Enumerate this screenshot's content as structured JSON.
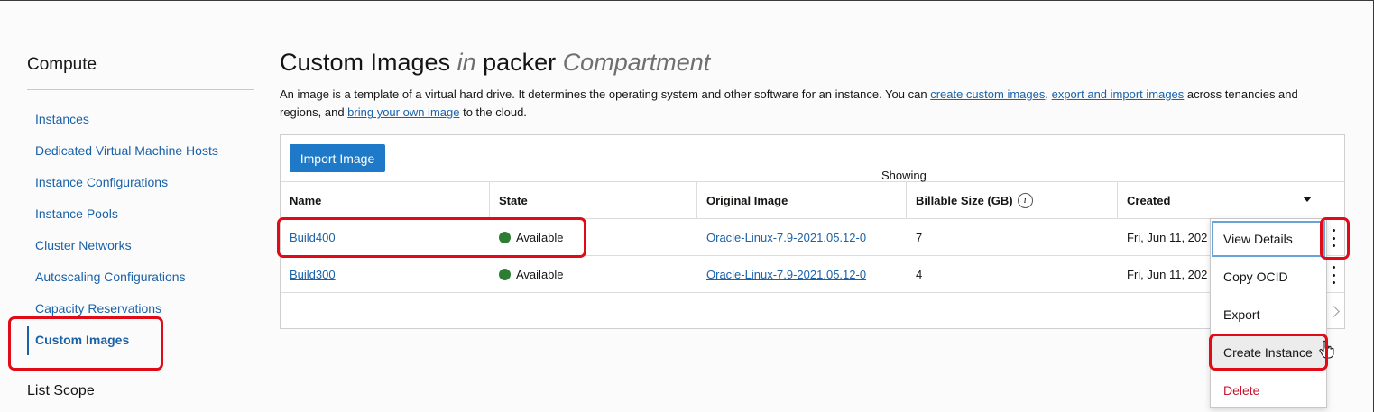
{
  "sidebar": {
    "title": "Compute",
    "items": [
      {
        "label": "Instances"
      },
      {
        "label": "Dedicated Virtual Machine Hosts"
      },
      {
        "label": "Instance Configurations"
      },
      {
        "label": "Instance Pools"
      },
      {
        "label": "Cluster Networks"
      },
      {
        "label": "Autoscaling Configurations"
      },
      {
        "label": "Capacity Reservations"
      },
      {
        "label": "Custom Images",
        "active": true
      }
    ],
    "list_scope_label": "List Scope"
  },
  "header": {
    "title_main": "Custom Images",
    "title_in": "in",
    "compartment": "packer",
    "compartment_suffix": "Compartment"
  },
  "description": {
    "part1": "An image is a template of a virtual hard drive. It determines the operating system and other software for an instance. You can ",
    "link1": "create custom images",
    "part2": ", ",
    "link2": "export and import images",
    "part3": " across tenancies and regions, and ",
    "link3": "bring your own image",
    "part4": " to the cloud."
  },
  "toolbar": {
    "import_label": "Import Image"
  },
  "table": {
    "columns": [
      "Name",
      "State",
      "Original Image",
      "Billable Size (GB)",
      "Created"
    ],
    "info_icon": "i",
    "rows": [
      {
        "name": "Build400",
        "state": "Available",
        "original_image": "Oracle-Linux-7.9-2021.05.12-0",
        "size": "7",
        "created": "Fri, Jun 11, 202"
      },
      {
        "name": "Build300",
        "state": "Available",
        "original_image": "Oracle-Linux-7.9-2021.05.12-0",
        "size": "4",
        "created": "Fri, Jun 11, 202"
      }
    ],
    "footer_text": "Showing"
  },
  "action_menu": {
    "items": [
      "View Details",
      "Copy OCID",
      "Export",
      "Create Instance",
      "Delete"
    ]
  },
  "colors": {
    "link": "#1a61a8",
    "primary_button": "#1e7ac8",
    "available_dot": "#2d7e34",
    "delete": "#c7152f",
    "highlight": "#e00b16"
  }
}
